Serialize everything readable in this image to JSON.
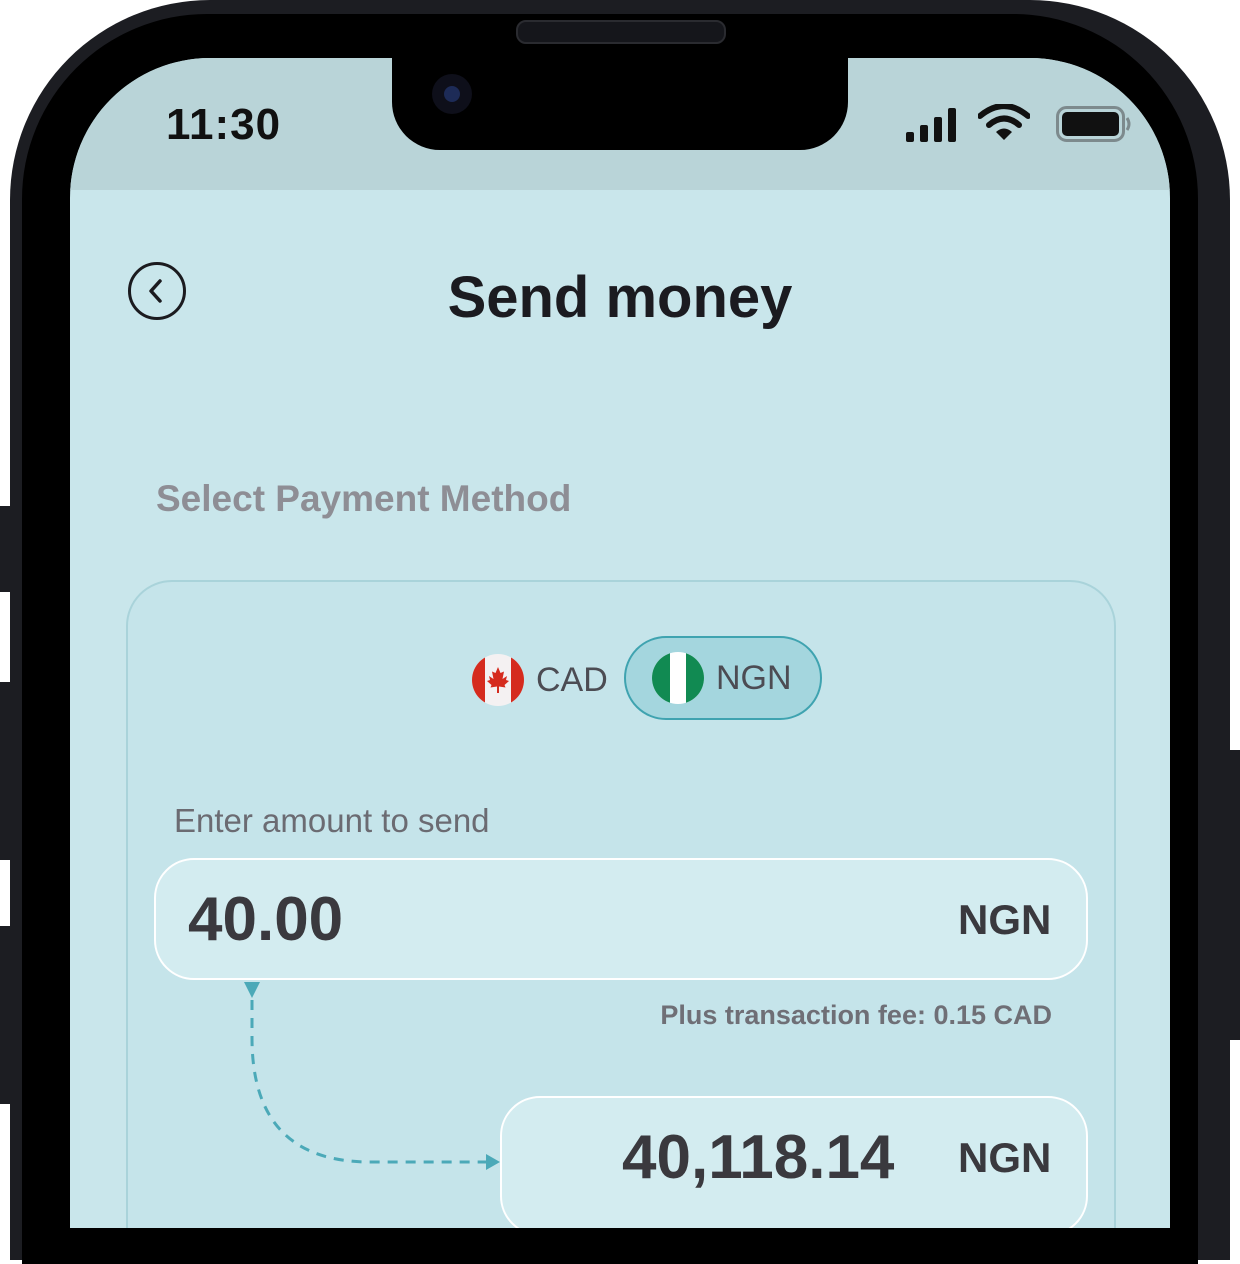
{
  "status_bar": {
    "time": "11:30",
    "icons": [
      "cellular-signal-icon",
      "wifi-icon",
      "battery-icon"
    ]
  },
  "header": {
    "title": "Send money",
    "back_icon": "chevron-left-icon"
  },
  "payment": {
    "section_label": "Select Payment Method",
    "currencies": [
      {
        "code": "CAD",
        "flag": "canada-flag-icon",
        "selected": false
      },
      {
        "code": "NGN",
        "flag": "nigeria-flag-icon",
        "selected": true
      }
    ]
  },
  "amount": {
    "label": "Enter amount to send",
    "value": "40.00",
    "currency": "NGN",
    "fee_text": "Plus transaction fee: 0.15 CAD"
  },
  "receive": {
    "value": "40,118.14",
    "currency": "NGN"
  },
  "colors": {
    "screen_bg": "#c9e6eb",
    "accent": "#3fa3b0",
    "selected_pill": "#a4d6de",
    "status_bar_bg": "#b9d4d8"
  }
}
